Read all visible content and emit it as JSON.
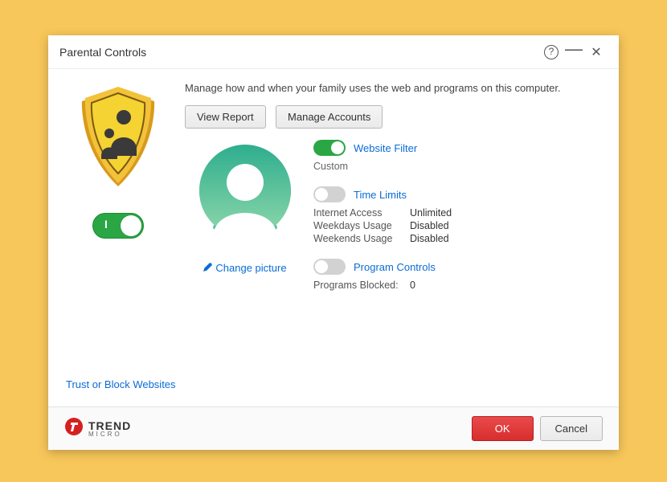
{
  "titlebar": {
    "title": "Parental Controls"
  },
  "description": "Manage how and when your family uses the web and programs on this computer.",
  "buttons": {
    "view_report": "View Report",
    "manage_accounts": "Manage Accounts"
  },
  "main_toggle": {
    "on": true,
    "label": "I"
  },
  "avatar": {
    "change_picture": "Change picture"
  },
  "settings": {
    "website_filter": {
      "label": "Website Filter",
      "on": true,
      "mode": "Custom"
    },
    "time_limits": {
      "label": "Time Limits",
      "on": false,
      "rows": [
        {
          "k": "Internet Access",
          "v": "Unlimited"
        },
        {
          "k": "Weekdays Usage",
          "v": "Disabled"
        },
        {
          "k": "Weekends Usage",
          "v": "Disabled"
        }
      ]
    },
    "program_controls": {
      "label": "Program Controls",
      "on": false,
      "rows": [
        {
          "k": "Programs Blocked:",
          "v": "0"
        }
      ]
    }
  },
  "bottom_link": "Trust or Block Websites",
  "brand": {
    "line1": "TREND",
    "line2": "MICRO"
  },
  "footer": {
    "ok": "OK",
    "cancel": "Cancel"
  }
}
